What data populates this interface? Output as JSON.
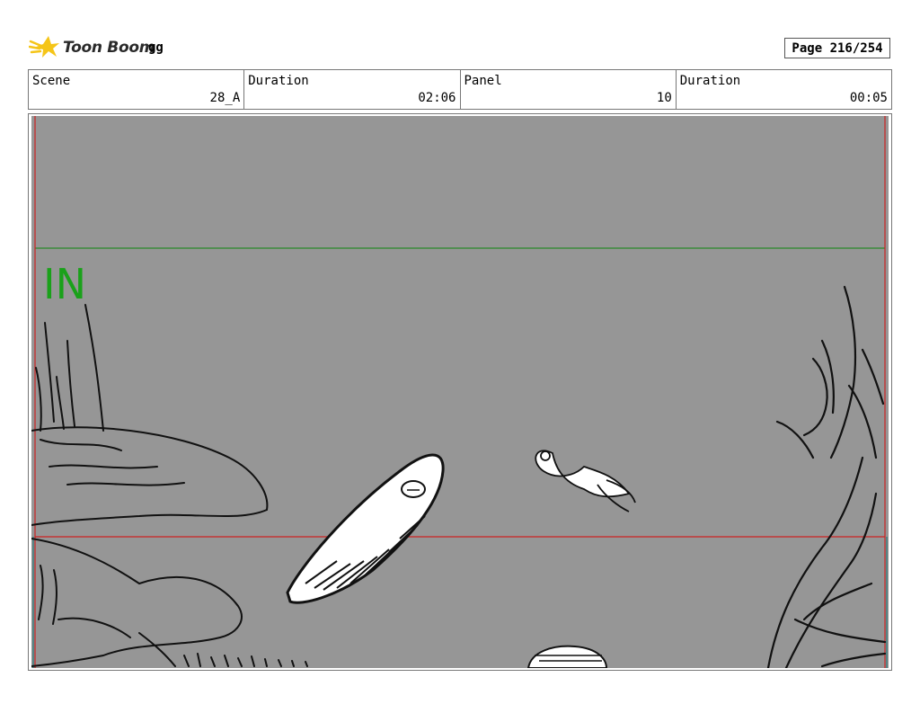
{
  "header": {
    "brand": "Toon Boom",
    "project": "gg",
    "page": "Page 216/254"
  },
  "info": {
    "scene_label": "Scene",
    "scene_value": "28_A",
    "duration_label": "Duration",
    "duration_value": "02:06",
    "panel_label": "Panel",
    "panel_value": "10",
    "panel_duration_label": "Duration",
    "panel_duration_value": "00:05"
  },
  "panel": {
    "annotation": "IN",
    "annotation_color": "#1aa11a",
    "background": "#969696",
    "guide_colors": {
      "red": "#cc2222",
      "green": "#2a8a2a"
    }
  }
}
